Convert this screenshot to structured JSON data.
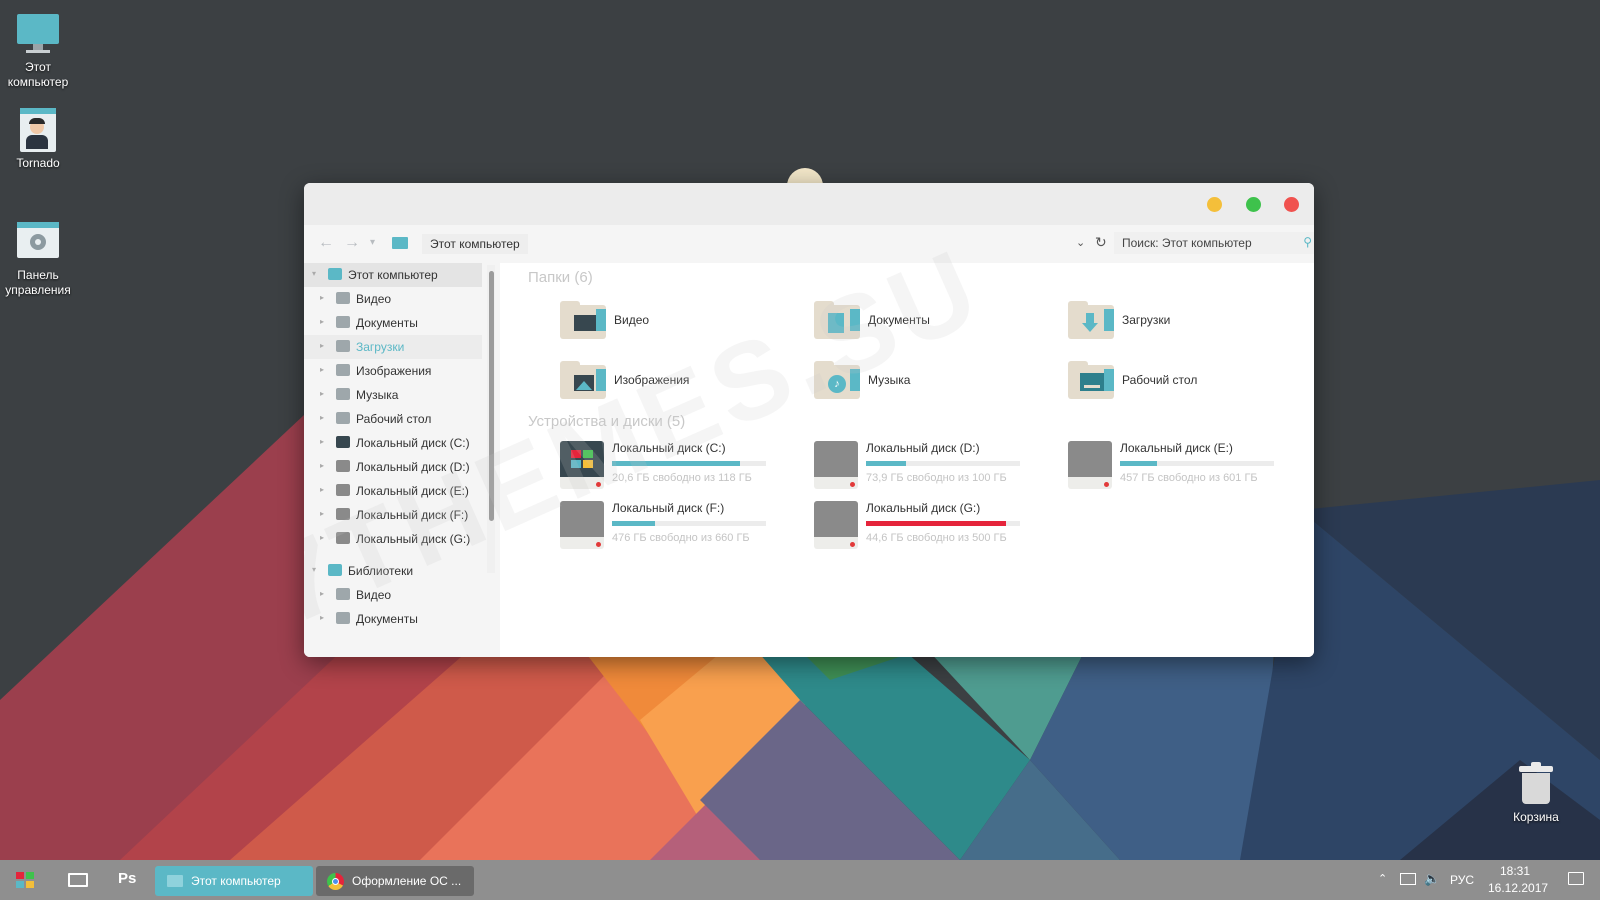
{
  "desktop": {
    "icons": [
      {
        "label": "Этот компьютер",
        "icon": "monitor-icon"
      },
      {
        "label": "Tornado",
        "icon": "user-avatar-icon"
      },
      {
        "label": "Панель управления",
        "icon": "control-panel-icon"
      },
      {
        "label": "Корзина",
        "icon": "recycle-bin-icon"
      }
    ]
  },
  "window": {
    "controls": {
      "minimize_color": "#f4bf3a",
      "maximize_color": "#3ec24c",
      "close_color": "#f0524f"
    },
    "breadcrumb": "Этот компьютер",
    "search_placeholder": "Поиск: Этот компьютер",
    "sidebar": {
      "root": "Этот компьютер",
      "items": [
        {
          "label": "Видео",
          "icon": "video-folder-icon"
        },
        {
          "label": "Документы",
          "icon": "documents-folder-icon"
        },
        {
          "label": "Загрузки",
          "icon": "downloads-folder-icon",
          "selected": true
        },
        {
          "label": "Изображения",
          "icon": "pictures-folder-icon"
        },
        {
          "label": "Музыка",
          "icon": "music-folder-icon"
        },
        {
          "label": "Рабочий стол",
          "icon": "desktop-folder-icon"
        },
        {
          "label": "Локальный диск (C:)",
          "icon": "drive-icon"
        },
        {
          "label": "Локальный диск (D:)",
          "icon": "drive-icon"
        },
        {
          "label": "Локальный диск (E:)",
          "icon": "drive-icon"
        },
        {
          "label": "Локальный диск (F:)",
          "icon": "drive-icon"
        },
        {
          "label": "Локальный диск (G:)",
          "icon": "drive-icon"
        }
      ],
      "libraries": "Библиотеки",
      "library_items": [
        {
          "label": "Видео"
        },
        {
          "label": "Документы"
        }
      ]
    },
    "folders_header": "Папки (6)",
    "folders": [
      {
        "label": "Видео",
        "icon": "video-folder-icon"
      },
      {
        "label": "Документы",
        "icon": "documents-folder-icon"
      },
      {
        "label": "Загрузки",
        "icon": "downloads-folder-icon"
      },
      {
        "label": "Изображения",
        "icon": "pictures-folder-icon"
      },
      {
        "label": "Музыка",
        "icon": "music-folder-icon"
      },
      {
        "label": "Рабочий стол",
        "icon": "desktop-folder-icon"
      }
    ],
    "drives_header": "Устройства и диски (5)",
    "drives": [
      {
        "name": "Локальный диск (C:)",
        "free": "20,6 ГБ свободно из 118 ГБ",
        "used_fraction": 0.83,
        "color": "#5bb8c6",
        "system": true
      },
      {
        "name": "Локальный диск (D:)",
        "free": "73,9 ГБ свободно из 100 ГБ",
        "used_fraction": 0.26,
        "color": "#5bb8c6"
      },
      {
        "name": "Локальный диск (E:)",
        "free": "457 ГБ свободно из 601 ГБ",
        "used_fraction": 0.24,
        "color": "#5bb8c6"
      },
      {
        "name": "Локальный диск (F:)",
        "free": "476 ГБ свободно из 660 ГБ",
        "used_fraction": 0.28,
        "color": "#5bb8c6"
      },
      {
        "name": "Локальный диск (G:)",
        "free": "44,6 ГБ свободно из 500 ГБ",
        "used_fraction": 0.91,
        "color": "#e5243b"
      }
    ]
  },
  "taskbar": {
    "start_icon": "windows-start-icon",
    "task_view_icon": "task-view-icon",
    "ps_label": "Ps",
    "items": [
      {
        "label": "Этот компьютер",
        "active": true
      },
      {
        "label": "Оформление ОС ...",
        "active": false
      }
    ],
    "tray": {
      "language": "РУС",
      "time": "18:31",
      "date": "16.12.2017"
    }
  },
  "watermark": "7THEMES.SU"
}
